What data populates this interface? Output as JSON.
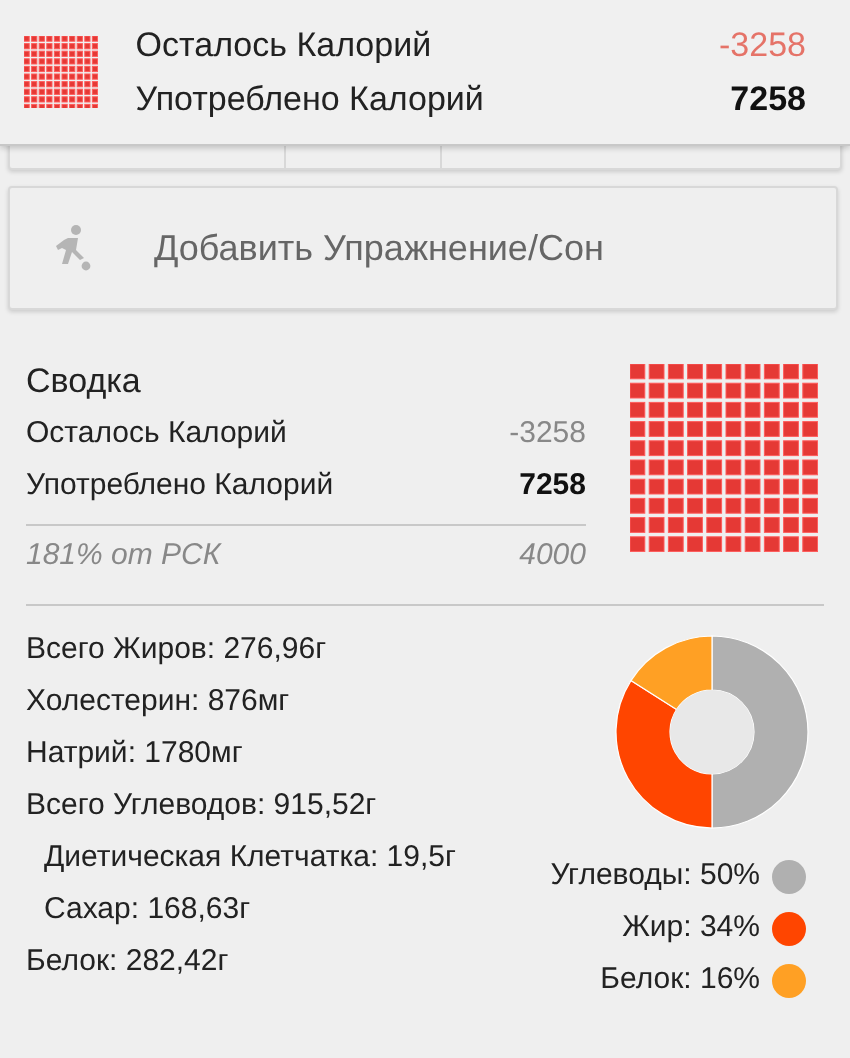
{
  "header": {
    "remaining_label": "Осталось Калорий",
    "remaining_value": "-3258",
    "consumed_label": "Употреблено Калорий",
    "consumed_value": "7258"
  },
  "add_exercise": {
    "label": "Добавить Упражнение/Сон"
  },
  "summary": {
    "title": "Сводка",
    "rows": [
      {
        "label": "Осталось Калорий",
        "value": "-3258",
        "kind": "muted"
      },
      {
        "label": "Употреблено Калорий",
        "value": "7258",
        "kind": "bold"
      }
    ],
    "footer_label": "181% от РСК",
    "footer_value": "4000"
  },
  "nutrients": [
    {
      "text": "Всего Жиров: 276,96г"
    },
    {
      "text": "Холестерин: 876мг"
    },
    {
      "text": "Натрий: 1780мг"
    },
    {
      "text": "Всего Углеводов: 915,52г",
      "children": [
        {
          "text": "Диетическая Клетчатка: 19,5г"
        },
        {
          "text": "Сахар: 168,63г"
        }
      ]
    },
    {
      "text": "Белок: 282,42г"
    }
  ],
  "macros": {
    "chart_data": {
      "type": "donut",
      "categories": [
        "Углеводы: 50%",
        "Жир: 34%",
        "Белок: 16%"
      ],
      "values": [
        50,
        34,
        16
      ]
    },
    "legend": [
      {
        "color": "#b0b0b0"
      },
      {
        "color": "#ff4500"
      },
      {
        "color": "#ffa024"
      }
    ]
  }
}
